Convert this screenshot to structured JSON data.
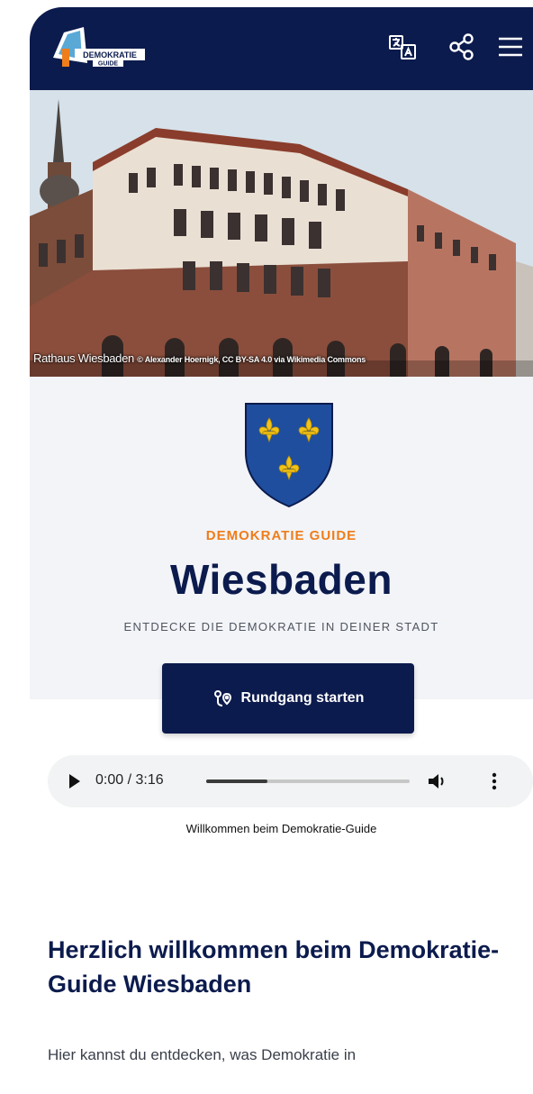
{
  "header": {
    "logo_text_line1": "DEMOKRATIE",
    "logo_text_line2": "GUIDE",
    "translate_icon": "translate-icon",
    "share_icon": "share-icon",
    "menu_icon": "hamburger-menu-icon",
    "bg_color": "#0c1b4d"
  },
  "hero": {
    "caption_title": "Rathaus Wiesbaden",
    "caption_credit": "© Alexander Hoernigk, CC BY-SA 4.0 via Wikimedia Commons"
  },
  "intro_panel": {
    "crest_icon": "wiesbaden-coat-of-arms-icon",
    "kicker": "DEMOKRATIE GUIDE",
    "city": "Wiesbaden",
    "tagline": "ENTDECKE DIE DEMOKRATIE IN DEINER STADT",
    "accent_color": "#ef7d1a"
  },
  "cta": {
    "label": "Rundgang starten",
    "icon": "route-pin-icon"
  },
  "audio": {
    "time": "0:00 / 3:16",
    "progress": 0.3,
    "caption": "Willkommen beim Demokratie-Guide"
  },
  "content": {
    "heading": "Herzlich willkommen beim Demokratie-Guide Wiesbaden",
    "paragraph": "Hier kannst du entdecken, was Demokratie in"
  }
}
